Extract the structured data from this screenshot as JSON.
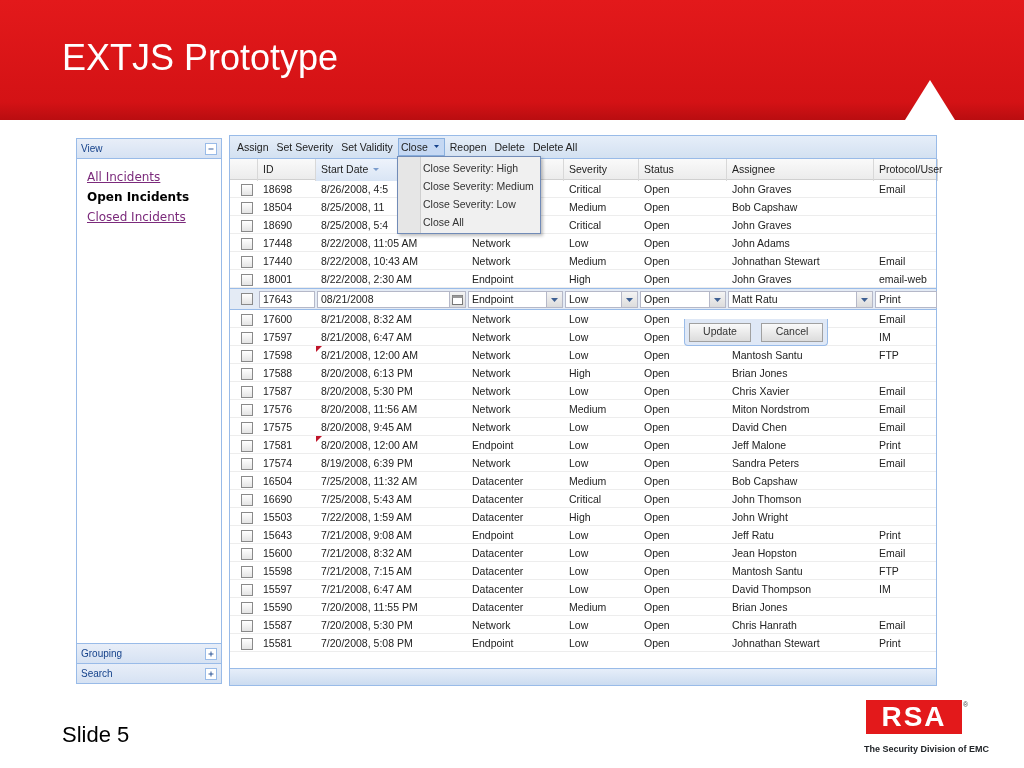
{
  "slide": {
    "title": "EXTJS Prototype",
    "footer": "Slide 5",
    "logo": {
      "mark": "RSA",
      "symbol": "®",
      "tagline": "The Security Division of EMC"
    }
  },
  "sidebar": {
    "panels": [
      {
        "title": "View",
        "expanded": true,
        "items": [
          {
            "label": "All Incidents",
            "selected": false
          },
          {
            "label": "Open Incidents",
            "selected": true
          },
          {
            "label": "Closed Incidents",
            "selected": false
          }
        ]
      },
      {
        "title": "Grouping",
        "expanded": false
      },
      {
        "title": "Search",
        "expanded": false
      }
    ]
  },
  "toolbar": [
    {
      "label": "Assign",
      "has_menu": false,
      "expanded": false
    },
    {
      "label": "Set Severity",
      "has_menu": false,
      "expanded": false
    },
    {
      "label": "Set Validity",
      "has_menu": false,
      "expanded": false
    },
    {
      "label": "Close",
      "has_menu": true,
      "expanded": true
    },
    {
      "label": "Reopen",
      "has_menu": false,
      "expanded": false
    },
    {
      "label": "Delete",
      "has_menu": false,
      "expanded": false
    },
    {
      "label": "Delete All",
      "has_menu": false,
      "expanded": false
    }
  ],
  "menu": {
    "items": [
      "Close Severity: High",
      "Close Severity: Medium",
      "Close Severity: Low",
      "Close All"
    ]
  },
  "grid": {
    "columns": [
      {},
      {
        "label": "ID"
      },
      {
        "label": "Start Date",
        "sorted_descending": true
      },
      {},
      {
        "label": "Severity"
      },
      {
        "label": "Status"
      },
      {
        "label": "Assignee"
      },
      {
        "label": "Protocol/User"
      }
    ],
    "rows": [
      {
        "checked": false,
        "modified": false,
        "cells": [
          "18698",
          "8/26/2008, 4:5",
          null,
          "Critical",
          "Open",
          "John Graves",
          "Email"
        ]
      },
      {
        "checked": false,
        "modified": false,
        "cells": [
          "18504",
          "8/25/2008, 11",
          null,
          "Medium",
          "Open",
          "Bob Capshaw",
          null
        ]
      },
      {
        "checked": false,
        "modified": false,
        "cells": [
          "18690",
          "8/25/2008, 5:4",
          null,
          "Critical",
          "Open",
          "John Graves",
          null
        ]
      },
      {
        "checked": false,
        "modified": false,
        "cells": [
          "17448",
          "8/22/2008, 11:05 AM",
          "Network",
          "Low",
          "Open",
          "John Adams",
          null
        ]
      },
      {
        "checked": false,
        "modified": false,
        "cells": [
          "17440",
          "8/22/2008, 10:43 AM",
          "Network",
          "Medium",
          "Open",
          "Johnathan Stewart",
          "Email"
        ]
      },
      {
        "checked": false,
        "modified": false,
        "cells": [
          "18001",
          "8/22/2008, 2:30 AM",
          "Endpoint",
          "High",
          "Open",
          "John Graves",
          "email-web"
        ]
      },
      {
        "kind": "editor",
        "checked": false,
        "fields": [
          {
            "kind": "text",
            "value": "17643"
          },
          {
            "kind": "date",
            "value": "08/21/2008"
          },
          {
            "kind": "combo",
            "value": "Endpoint"
          },
          {
            "kind": "combo",
            "value": "Low"
          },
          {
            "kind": "combo",
            "value": "Open"
          },
          {
            "kind": "combo",
            "value": "Matt Ratu"
          },
          {
            "kind": "text",
            "value": "Print"
          }
        ],
        "buttons": [
          "Update",
          "Cancel"
        ]
      },
      {
        "checked": false,
        "modified": false,
        "cells": [
          "17600",
          "8/21/2008, 8:32 AM",
          "Network",
          "Low",
          "Open",
          null,
          "Email"
        ]
      },
      {
        "checked": false,
        "modified": false,
        "cells": [
          "17597",
          "8/21/2008, 6:47 AM",
          "Network",
          "Low",
          "Open",
          null,
          "IM"
        ]
      },
      {
        "checked": false,
        "modified": true,
        "cells": [
          "17598",
          "8/21/2008, 12:00 AM",
          "Network",
          "Low",
          "Open",
          "Mantosh Santu",
          "FTP"
        ]
      },
      {
        "checked": false,
        "modified": false,
        "cells": [
          "17588",
          "8/20/2008, 6:13 PM",
          "Network",
          "High",
          "Open",
          "Brian Jones",
          null
        ]
      },
      {
        "checked": false,
        "modified": false,
        "cells": [
          "17587",
          "8/20/2008, 5:30 PM",
          "Network",
          "Low",
          "Open",
          "Chris Xavier",
          "Email"
        ]
      },
      {
        "checked": false,
        "modified": false,
        "cells": [
          "17576",
          "8/20/2008, 11:56 AM",
          "Network",
          "Medium",
          "Open",
          "Miton Nordstrom",
          "Email"
        ]
      },
      {
        "checked": false,
        "modified": false,
        "cells": [
          "17575",
          "8/20/2008, 9:45 AM",
          "Network",
          "Low",
          "Open",
          "David Chen",
          "Email"
        ]
      },
      {
        "checked": false,
        "modified": true,
        "cells": [
          "17581",
          "8/20/2008, 12:00 AM",
          "Endpoint",
          "Low",
          "Open",
          "Jeff Malone",
          "Print"
        ]
      },
      {
        "checked": false,
        "modified": false,
        "cells": [
          "17574",
          "8/19/2008, 6:39 PM",
          "Network",
          "Low",
          "Open",
          "Sandra Peters",
          "Email"
        ]
      },
      {
        "checked": false,
        "modified": false,
        "cells": [
          "16504",
          "7/25/2008, 11:32 AM",
          "Datacenter",
          "Medium",
          "Open",
          "Bob Capshaw",
          null
        ]
      },
      {
        "checked": false,
        "modified": false,
        "cells": [
          "16690",
          "7/25/2008, 5:43 AM",
          "Datacenter",
          "Critical",
          "Open",
          "John Thomson",
          null
        ]
      },
      {
        "checked": false,
        "modified": false,
        "cells": [
          "15503",
          "7/22/2008, 1:59 AM",
          "Datacenter",
          "High",
          "Open",
          "John Wright",
          null
        ]
      },
      {
        "checked": false,
        "modified": false,
        "cells": [
          "15643",
          "7/21/2008, 9:08 AM",
          "Endpoint",
          "Low",
          "Open",
          "Jeff Ratu",
          "Print"
        ]
      },
      {
        "checked": false,
        "modified": false,
        "cells": [
          "15600",
          "7/21/2008, 8:32 AM",
          "Datacenter",
          "Low",
          "Open",
          "Jean Hopston",
          "Email"
        ]
      },
      {
        "checked": false,
        "modified": false,
        "cells": [
          "15598",
          "7/21/2008, 7:15 AM",
          "Datacenter",
          "Low",
          "Open",
          "Mantosh Santu",
          "FTP"
        ]
      },
      {
        "checked": false,
        "modified": false,
        "cells": [
          "15597",
          "7/21/2008, 6:47 AM",
          "Datacenter",
          "Low",
          "Open",
          "David Thompson",
          "IM"
        ]
      },
      {
        "checked": false,
        "modified": false,
        "cells": [
          "15590",
          "7/20/2008, 11:55 PM",
          "Datacenter",
          "Medium",
          "Open",
          "Brian Jones",
          null
        ]
      },
      {
        "checked": false,
        "modified": false,
        "cells": [
          "15587",
          "7/20/2008, 5:30 PM",
          "Network",
          "Low",
          "Open",
          "Chris Hanrath",
          "Email"
        ]
      },
      {
        "checked": false,
        "modified": false,
        "cells": [
          "15581",
          "7/20/2008, 5:08 PM",
          "Endpoint",
          "Low",
          "Open",
          "Johnathan Stewart",
          "Print"
        ]
      }
    ]
  }
}
